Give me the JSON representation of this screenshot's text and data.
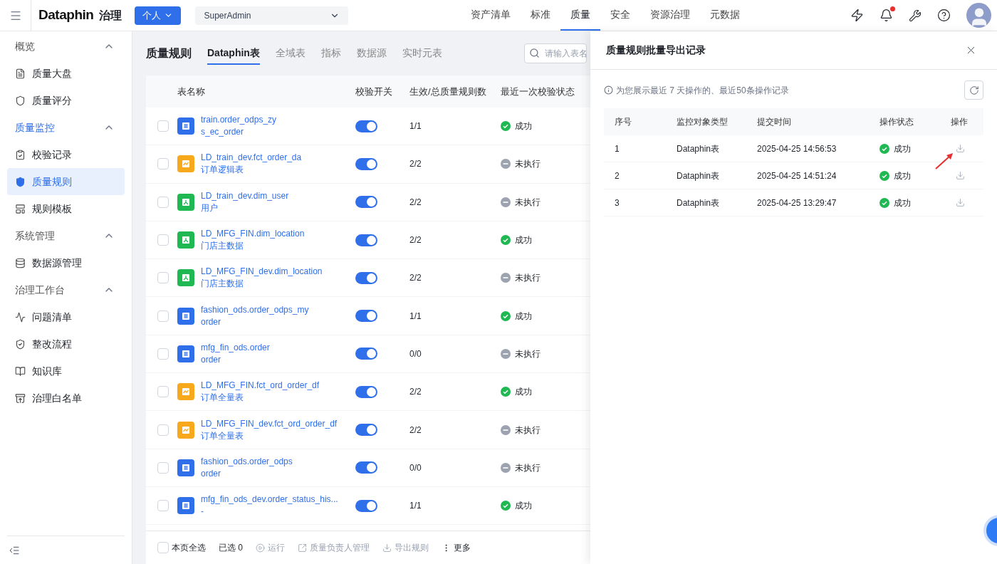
{
  "topbar": {
    "logo": "Dataphin",
    "product": "治理",
    "scope_button": "个人",
    "tenant": "SuperAdmin",
    "nav": [
      {
        "label": "资产清单",
        "selected": false
      },
      {
        "label": "标准",
        "selected": false
      },
      {
        "label": "质量",
        "selected": true
      },
      {
        "label": "安全",
        "selected": false
      },
      {
        "label": "资源治理",
        "selected": false
      },
      {
        "label": "元数据",
        "selected": false
      }
    ]
  },
  "sidebar": {
    "sections": [
      {
        "label": "概览",
        "expanded": true,
        "selected": false,
        "items": [
          {
            "label": "质量大盘",
            "selected": false
          },
          {
            "label": "质量评分",
            "selected": false
          }
        ]
      },
      {
        "label": "质量监控",
        "expanded": true,
        "selected": true,
        "items": [
          {
            "label": "校验记录",
            "selected": false
          },
          {
            "label": "质量规则",
            "selected": true
          },
          {
            "label": "规则模板",
            "selected": false
          }
        ]
      },
      {
        "label": "系统管理",
        "expanded": true,
        "selected": false,
        "items": [
          {
            "label": "数据源管理",
            "selected": false
          }
        ]
      },
      {
        "label": "治理工作台",
        "expanded": true,
        "selected": false,
        "items": [
          {
            "label": "问题清单",
            "selected": false
          },
          {
            "label": "整改流程",
            "selected": false
          },
          {
            "label": "知识库",
            "selected": false
          },
          {
            "label": "治理白名单",
            "selected": false
          }
        ]
      }
    ]
  },
  "page": {
    "title": "质量规则",
    "tabs": [
      {
        "label": "Dataphin表",
        "selected": true
      },
      {
        "label": "全域表",
        "selected": false
      },
      {
        "label": "指标",
        "selected": false
      },
      {
        "label": "数据源",
        "selected": false
      },
      {
        "label": "实时元表",
        "selected": false
      }
    ],
    "search": {
      "placeholder": "请输入表名"
    }
  },
  "table": {
    "columns": [
      "表名称",
      "校验开关",
      "生效/总质量规则数",
      "最近一次校验状态"
    ],
    "rows": [
      {
        "name": "train.order_odps_zy",
        "alias": "s_ec_order",
        "kind": "table",
        "checked": false,
        "enabled": true,
        "rule_count": "1/1",
        "status": {
          "kind": "success",
          "label": "成功"
        }
      },
      {
        "name": "LD_train_dev.fct_order_da",
        "alias": "订单逻辑表",
        "kind": "logic",
        "checked": false,
        "enabled": true,
        "rule_count": "2/2",
        "status": {
          "kind": "pending",
          "label": "未执行"
        }
      },
      {
        "name": "LD_train_dev.dim_user",
        "alias": "用户",
        "kind": "dim",
        "checked": false,
        "enabled": true,
        "rule_count": "2/2",
        "status": {
          "kind": "pending",
          "label": "未执行"
        }
      },
      {
        "name": "LD_MFG_FIN.dim_location",
        "alias": "门店主数据",
        "kind": "dim",
        "checked": false,
        "enabled": true,
        "rule_count": "2/2",
        "status": {
          "kind": "success",
          "label": "成功"
        }
      },
      {
        "name": "LD_MFG_FIN_dev.dim_location",
        "alias": "门店主数据",
        "kind": "dim",
        "checked": false,
        "enabled": true,
        "rule_count": "2/2",
        "status": {
          "kind": "pending",
          "label": "未执行"
        }
      },
      {
        "name": "fashion_ods.order_odps_my",
        "alias": "order",
        "kind": "table",
        "checked": false,
        "enabled": true,
        "rule_count": "1/1",
        "status": {
          "kind": "success",
          "label": "成功"
        }
      },
      {
        "name": "mfg_fin_ods.order",
        "alias": "order",
        "kind": "table",
        "checked": false,
        "enabled": true,
        "rule_count": "0/0",
        "status": {
          "kind": "pending",
          "label": "未执行"
        }
      },
      {
        "name": "LD_MFG_FIN.fct_ord_order_df",
        "alias": "订单全量表",
        "kind": "logic",
        "checked": false,
        "enabled": true,
        "rule_count": "2/2",
        "status": {
          "kind": "success",
          "label": "成功"
        }
      },
      {
        "name": "LD_MFG_FIN_dev.fct_ord_order_df",
        "alias": "订单全量表",
        "kind": "logic",
        "checked": false,
        "enabled": true,
        "rule_count": "2/2",
        "status": {
          "kind": "pending",
          "label": "未执行"
        }
      },
      {
        "name": "fashion_ods.order_odps",
        "alias": "order",
        "kind": "table",
        "checked": false,
        "enabled": true,
        "rule_count": "0/0",
        "status": {
          "kind": "pending",
          "label": "未执行"
        }
      },
      {
        "name": "mfg_fin_ods_dev.order_status_his...",
        "alias": "-",
        "kind": "table",
        "checked": false,
        "enabled": true,
        "rule_count": "1/1",
        "status": {
          "kind": "success",
          "label": "成功"
        }
      }
    ]
  },
  "footer": {
    "select_all": {
      "label": "本页全选",
      "checked": false
    },
    "selected_count": "已选 0",
    "actions": [
      {
        "kind": "run",
        "label": "运行",
        "disabled": true
      },
      {
        "kind": "owner",
        "label": "质量负责人管理",
        "disabled": true
      },
      {
        "kind": "export",
        "label": "导出规则",
        "disabled": true
      },
      {
        "kind": "more",
        "label": "更多",
        "disabled": false
      }
    ]
  },
  "drawer": {
    "title": "质量规则批量导出记录",
    "notice": "为您展示最近 7 天操作的、最近50条操作记录",
    "columns": [
      "序号",
      "监控对象类型",
      "提交时间",
      "操作状态",
      "操作"
    ],
    "rows": [
      {
        "index": "1",
        "type": "Dataphin表",
        "time": "2025-04-25 14:56:53",
        "status": {
          "kind": "success",
          "label": "成功"
        }
      },
      {
        "index": "2",
        "type": "Dataphin表",
        "time": "2025-04-25 14:51:24",
        "status": {
          "kind": "success",
          "label": "成功"
        }
      },
      {
        "index": "3",
        "type": "Dataphin表",
        "time": "2025-04-25 13:29:47",
        "status": {
          "kind": "success",
          "label": "成功"
        }
      }
    ]
  }
}
